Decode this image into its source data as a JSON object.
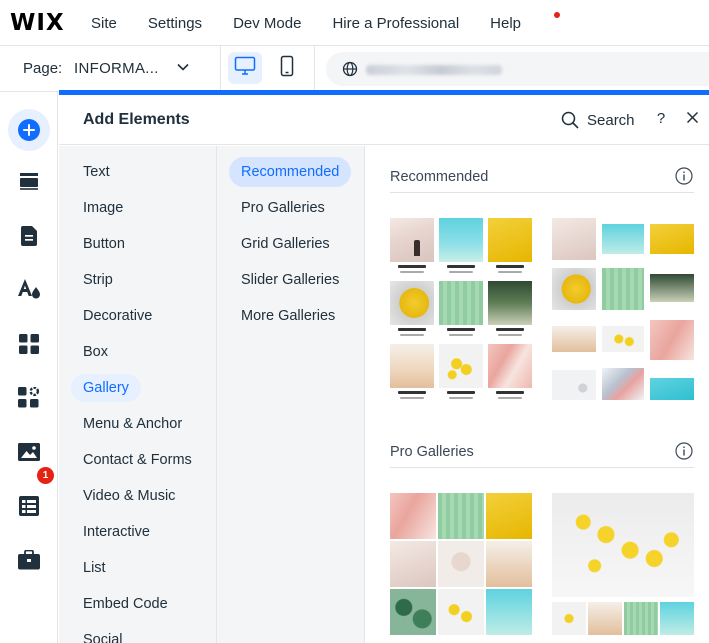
{
  "app": {
    "logo": "WIX"
  },
  "top_menu": {
    "items": [
      "Site",
      "Settings",
      "Dev Mode",
      "Hire a Professional",
      "Help"
    ]
  },
  "page_bar": {
    "label": "Page:",
    "page_name": "INFORMA..."
  },
  "panel": {
    "title": "Add Elements",
    "search_label": "Search",
    "help_label": "?"
  },
  "categories": [
    "Text",
    "Image",
    "Button",
    "Strip",
    "Decorative",
    "Box",
    "Gallery",
    "Menu & Anchor",
    "Contact & Forms",
    "Video & Music",
    "Interactive",
    "List",
    "Embed Code",
    "Social"
  ],
  "active_category": "Gallery",
  "subcategories": [
    "Recommended",
    "Pro Galleries",
    "Grid Galleries",
    "Slider Galleries",
    "More Galleries"
  ],
  "active_subcategory": "Recommended",
  "sections": [
    "Recommended",
    "Pro Galleries"
  ],
  "rail": {
    "icons": [
      "add-icon",
      "pages-icon",
      "page-icon",
      "design-icon",
      "apps-icon",
      "business-icon",
      "media-icon",
      "cms-icon",
      "portfolio-icon"
    ],
    "badge_count": "1"
  },
  "colors": {
    "accent": "#116dff",
    "accent_light": "#e7f0ff",
    "badge": "#e62214",
    "panel_bg": "#f4f5f7"
  }
}
